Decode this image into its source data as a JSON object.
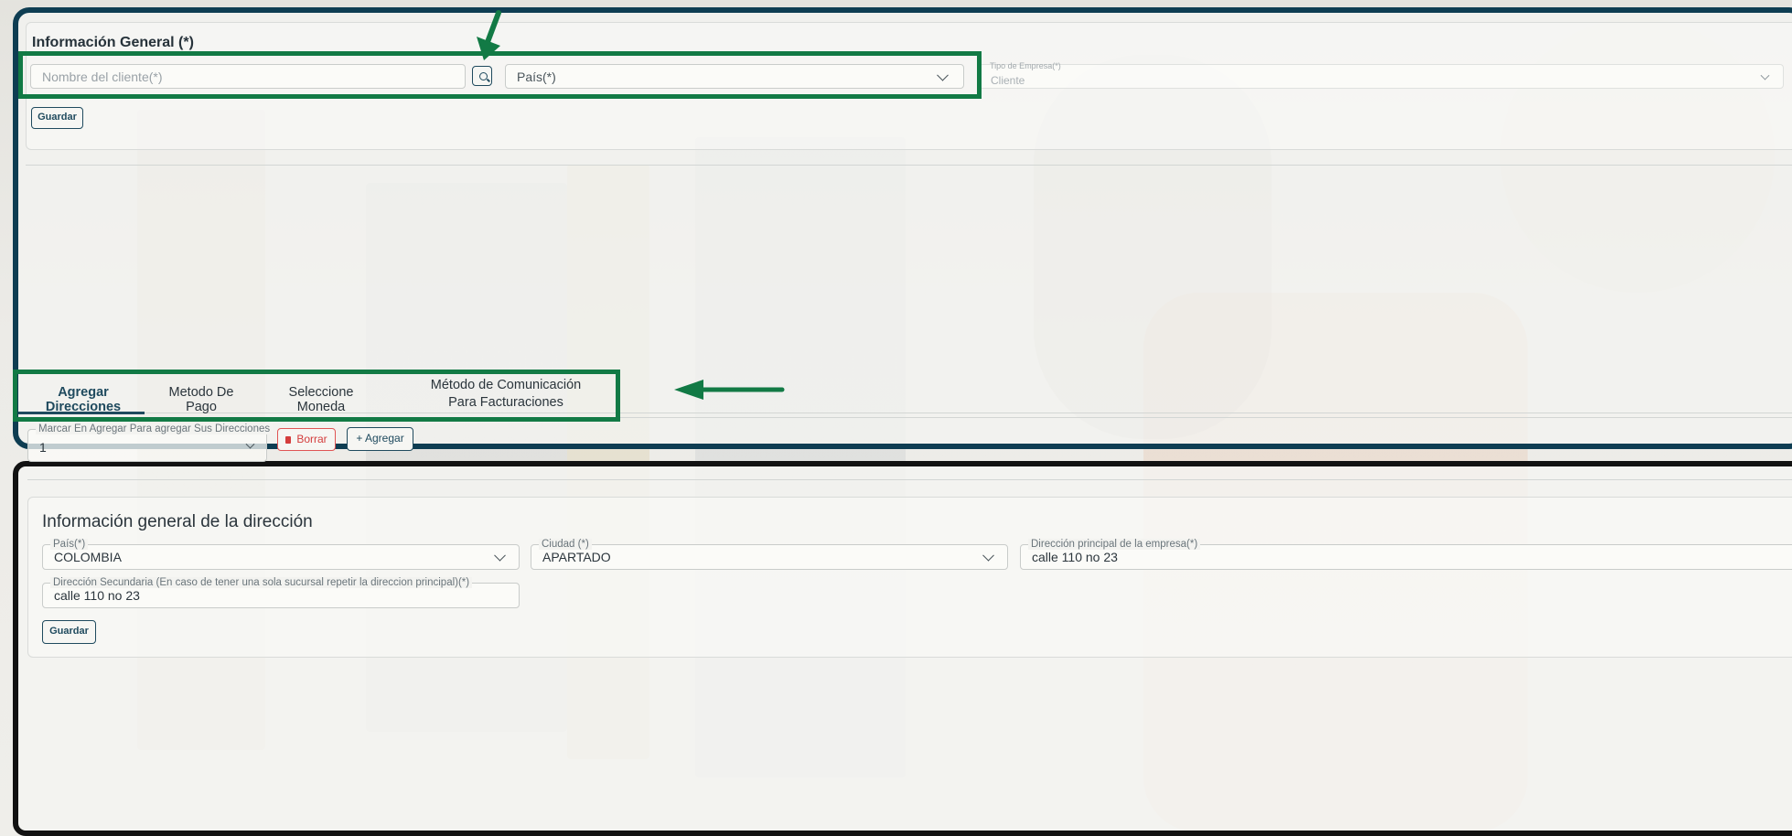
{
  "general_section": {
    "title": "Información General (*)",
    "client_name_placeholder": "Nombre del cliente(*)",
    "search_icon": "search-icon",
    "country_placeholder": "País(*)",
    "company_type_label": "Tipo de Empresa(*)",
    "company_type_value": "Cliente",
    "save_label": "Guardar"
  },
  "tabs": [
    {
      "label": "Agregar Direcciones",
      "active": true
    },
    {
      "label": "Metodo De Pago",
      "active": false
    },
    {
      "label": "Seleccione Moneda",
      "active": false
    },
    {
      "label": "Método de Comunicación Para Facturaciones",
      "active": false
    }
  ],
  "address_toolbar": {
    "select_label": "Marcar En Agregar Para agregar Sus Direcciones",
    "select_value": "1",
    "delete_label": "Borrar",
    "delete_icon": "trash-icon",
    "add_label": "+ Agregar"
  },
  "address_section": {
    "title": "Información general de la dirección",
    "country_label": "País(*)",
    "country_value": "COLOMBIA",
    "city_label": "Ciudad (*)",
    "city_value": "APARTADO",
    "main_address_label": "Dirección principal de la empresa(*)",
    "main_address_value": "calle 110 no 23",
    "secondary_address_label": "Dirección Secundaria (En caso de tener una sola sucursal repetir la direccion principal)(*)",
    "secondary_address_value": "calle 110 no 23",
    "save_label": "Guardar"
  },
  "colors": {
    "highlight": "#127a45",
    "primary": "#1f4a5e",
    "danger": "#e05454",
    "top_frame": "#0e3d52"
  }
}
